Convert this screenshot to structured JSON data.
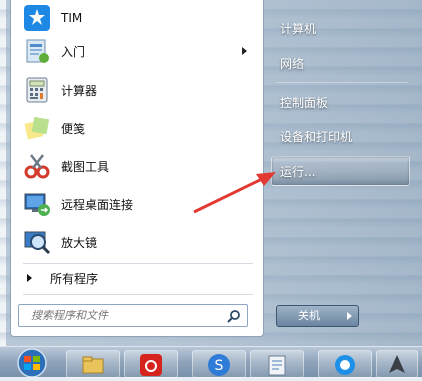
{
  "start_menu": {
    "programs": [
      {
        "label": "TIM",
        "icon": "tim-icon",
        "has_submenu": false
      },
      {
        "label": "入门",
        "icon": "getting-started-icon",
        "has_submenu": true
      },
      {
        "label": "计算器",
        "icon": "calculator-icon",
        "has_submenu": false
      },
      {
        "label": "便笺",
        "icon": "sticky-notes-icon",
        "has_submenu": false
      },
      {
        "label": "截图工具",
        "icon": "snipping-tool-icon",
        "has_submenu": false
      },
      {
        "label": "远程桌面连接",
        "icon": "remote-desktop-icon",
        "has_submenu": false
      },
      {
        "label": "放大镜",
        "icon": "magnifier-icon",
        "has_submenu": false
      }
    ],
    "all_programs_label": "所有程序",
    "search": {
      "placeholder": "搜索程序和文件",
      "icon": "search-icon"
    },
    "right_items": [
      {
        "label": "计算机"
      },
      {
        "label": "网络"
      },
      {
        "label": "控制面板"
      },
      {
        "label": "设备和打印机"
      },
      {
        "label": "运行..."
      }
    ],
    "shutdown_label": "关机",
    "highlighted_item": "运行...",
    "colors": {
      "annotation_arrow": "#e23a33",
      "taskbar": "#8ea3ba"
    }
  },
  "taskbar": {
    "buttons": [
      {
        "icon": "start-orb-icon"
      },
      {
        "icon": "file-explorer-icon"
      },
      {
        "icon": "netease-music-icon"
      },
      {
        "icon": "sogou-icon"
      },
      {
        "icon": "notes-app-icon"
      },
      {
        "icon": "qq-browser-icon"
      },
      {
        "icon": "pen-tool-icon"
      }
    ]
  }
}
